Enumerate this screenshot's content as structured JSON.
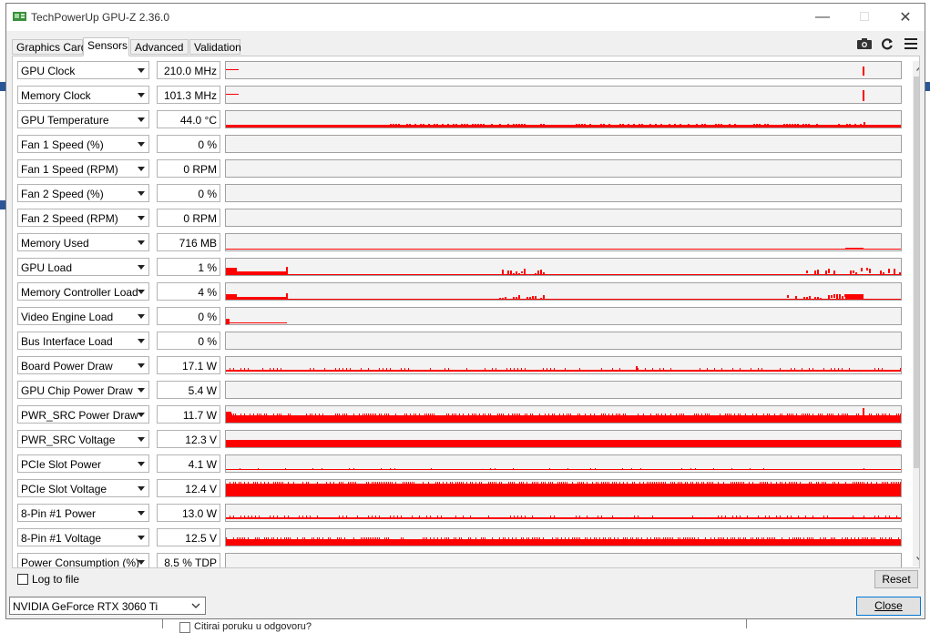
{
  "window": {
    "title": "TechPowerUp GPU-Z 2.36.0"
  },
  "tabs": [
    {
      "label": "Graphics Card",
      "active": false
    },
    {
      "label": "Sensors",
      "active": true
    },
    {
      "label": "Advanced",
      "active": false
    },
    {
      "label": "Validation",
      "active": false
    }
  ],
  "toolbar": {
    "icons": [
      "camera-icon",
      "refresh-icon",
      "menu-icon"
    ]
  },
  "sensors": [
    {
      "label": "GPU Clock",
      "value": "210.0 MHz"
    },
    {
      "label": "Memory Clock",
      "value": "101.3 MHz"
    },
    {
      "label": "GPU Temperature",
      "value": "44.0 °C"
    },
    {
      "label": "Fan 1 Speed (%)",
      "value": "0 %"
    },
    {
      "label": "Fan 1 Speed (RPM)",
      "value": "0 RPM"
    },
    {
      "label": "Fan 2 Speed (%)",
      "value": "0 %"
    },
    {
      "label": "Fan 2 Speed (RPM)",
      "value": "0 RPM"
    },
    {
      "label": "Memory Used",
      "value": "716 MB"
    },
    {
      "label": "GPU Load",
      "value": "1 %"
    },
    {
      "label": "Memory Controller Load",
      "value": "4 %"
    },
    {
      "label": "Video Engine Load",
      "value": "0 %"
    },
    {
      "label": "Bus Interface Load",
      "value": "0 %"
    },
    {
      "label": "Board Power Draw",
      "value": "17.1 W"
    },
    {
      "label": "GPU Chip Power Draw",
      "value": "5.4 W"
    },
    {
      "label": "PWR_SRC Power Draw",
      "value": "11.7 W"
    },
    {
      "label": "PWR_SRC Voltage",
      "value": "12.3 V"
    },
    {
      "label": "PCIe Slot Power",
      "value": "4.1 W"
    },
    {
      "label": "PCIe Slot Voltage",
      "value": "12.4 V"
    },
    {
      "label": "8-Pin #1 Power",
      "value": "13.0 W"
    },
    {
      "label": "8-Pin #1 Voltage",
      "value": "12.5 V"
    },
    {
      "label": "Power Consumption (%)",
      "value": "8.5 % TDP"
    }
  ],
  "footer": {
    "log_label": "Log to file",
    "reset_label": "Reset",
    "gpu_selected": "NVIDIA GeForce RTX 3060 Ti",
    "close_label": "Close"
  },
  "background": {
    "partial_text": "Citirai poruku u odgovoru?"
  },
  "colors": {
    "graph": "#ff0000",
    "graph_bg": "#f3f3f3"
  }
}
